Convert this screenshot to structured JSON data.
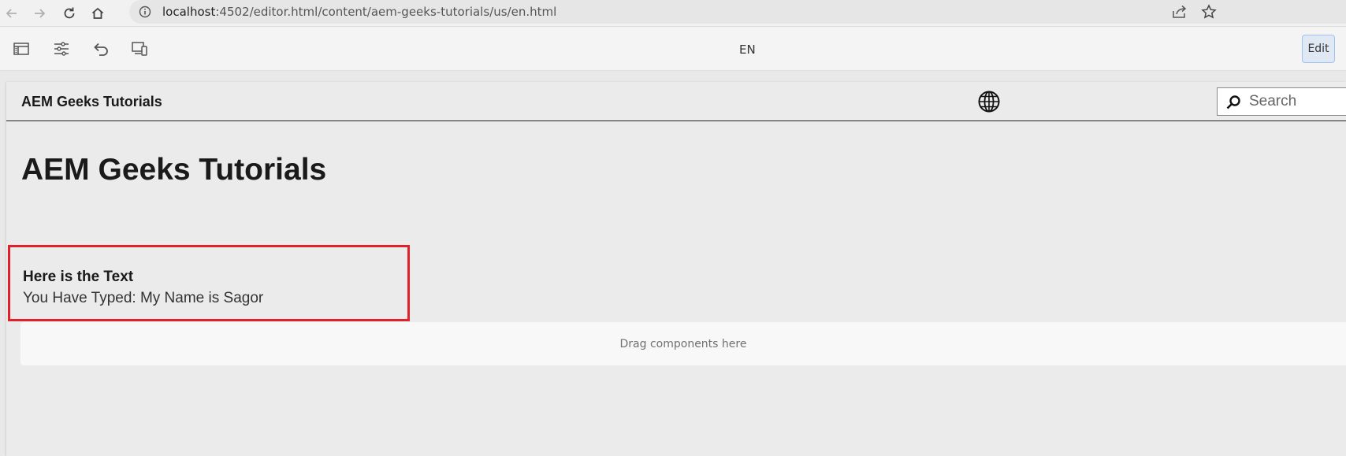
{
  "browser": {
    "url_host": "localhost",
    "url_rest": ":4502/editor.html/content/aem-geeks-tutorials/us/en.html"
  },
  "toolbar": {
    "language": "EN",
    "edit_label": "Edit"
  },
  "site": {
    "brand": "AEM Geeks Tutorials",
    "search_placeholder": "Search"
  },
  "main": {
    "page_title": "AEM Geeks Tutorials",
    "text_component": {
      "heading": "Here is the Text",
      "body": "You Have Typed: My Name is Sagor"
    },
    "drop_zone_label": "Drag components here"
  },
  "colors": {
    "highlight_border": "#e0202a",
    "edit_button_bg": "#e0e8f3"
  }
}
